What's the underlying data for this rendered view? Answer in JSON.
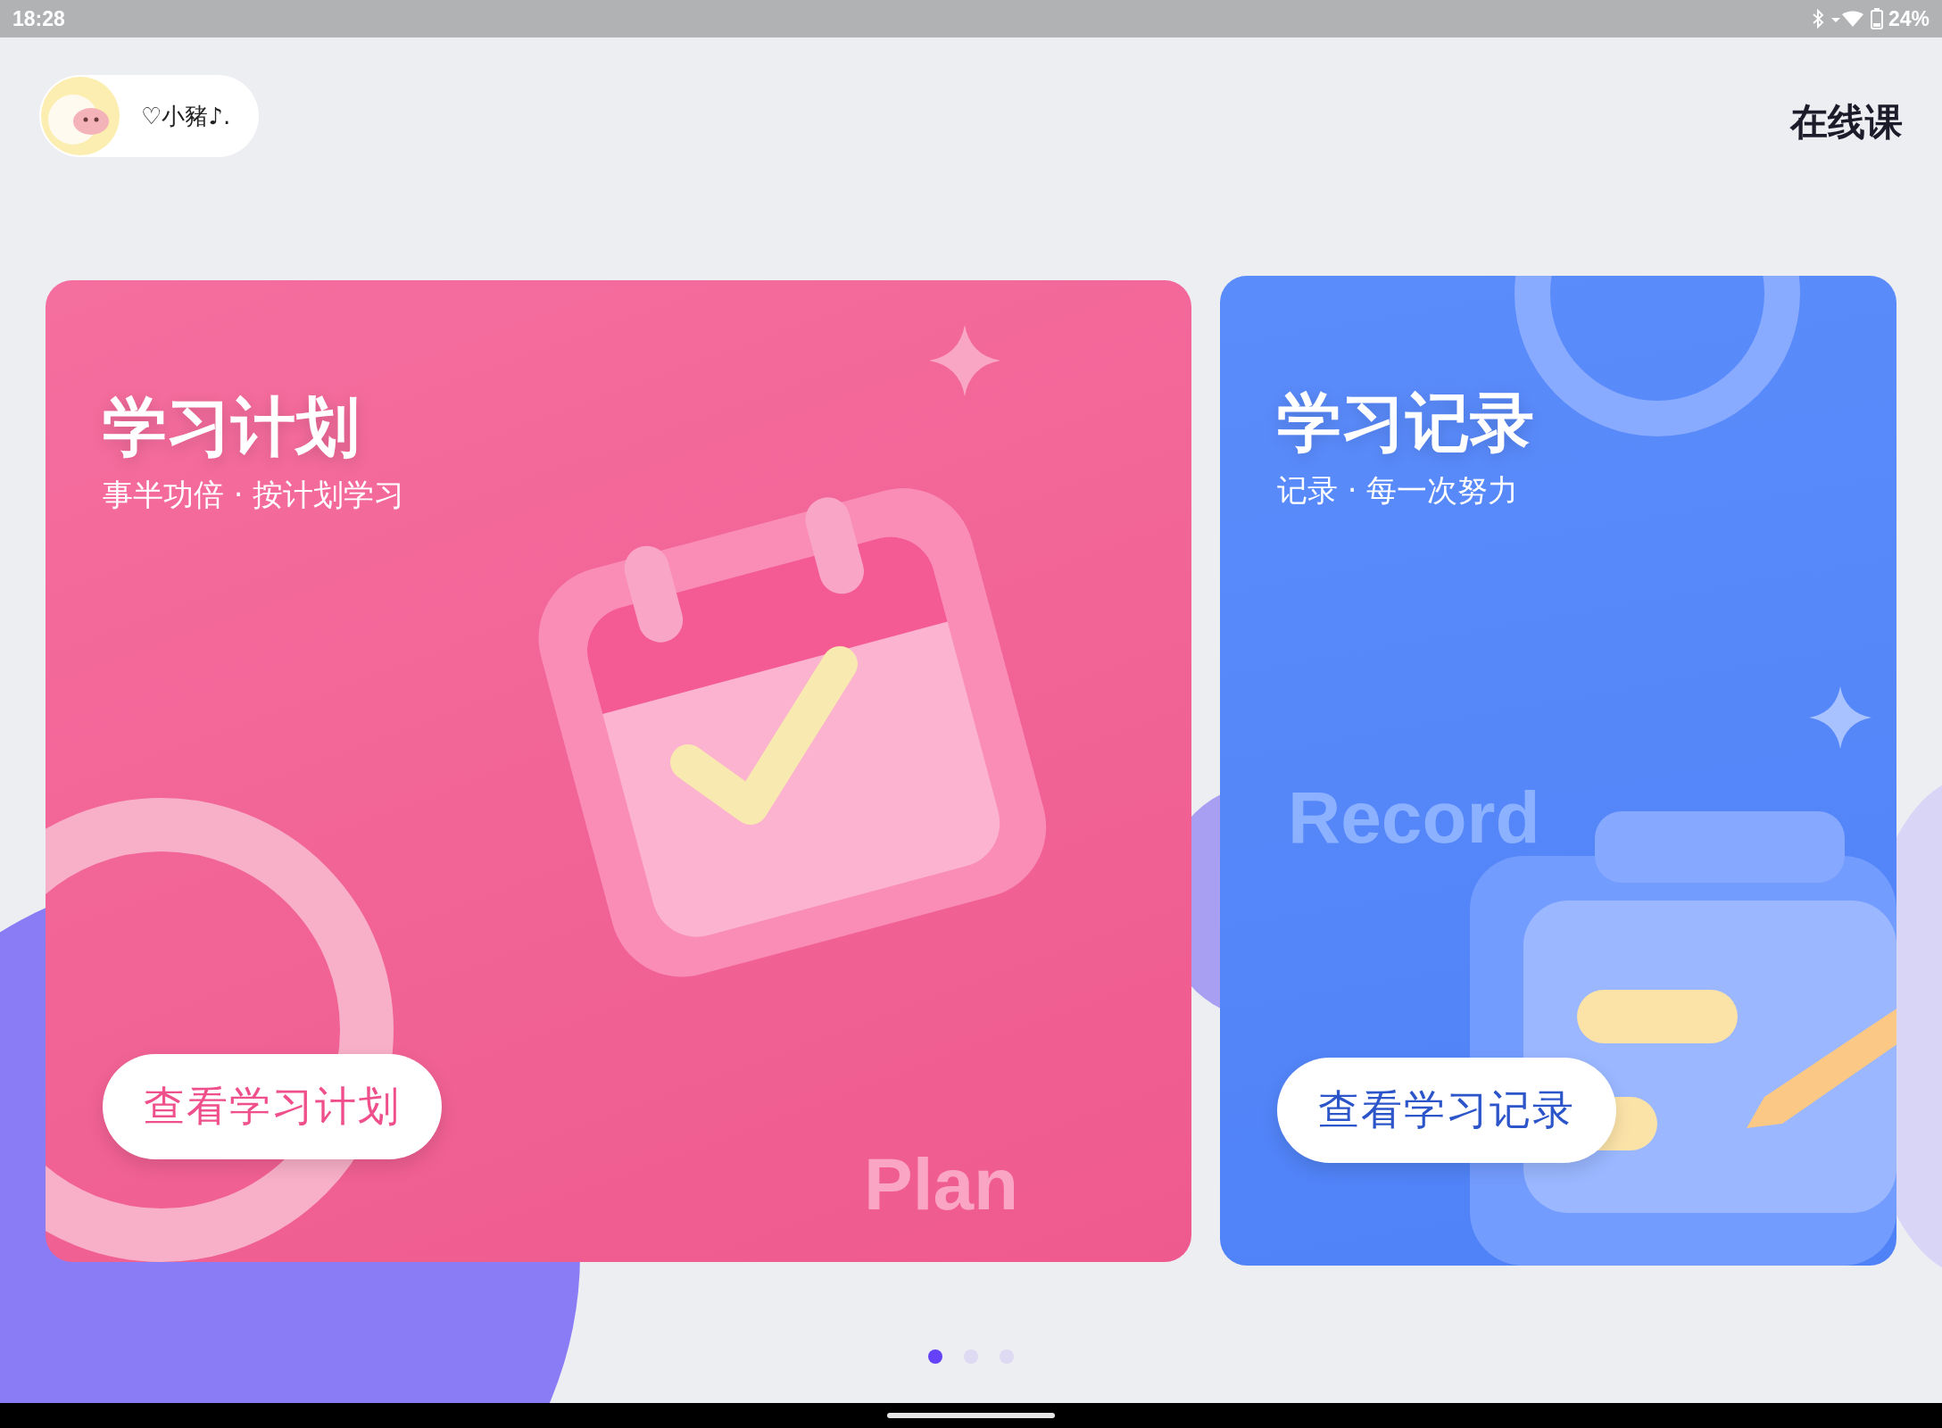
{
  "status_bar": {
    "time": "18:28",
    "battery_text": "24%"
  },
  "header": {
    "user_name": "♡小豬♪.",
    "title": "在线课"
  },
  "cards": [
    {
      "kind": "plan",
      "title": "学习计划",
      "subtitle": "事半功倍 · 按计划学习",
      "button": "查看学习计划",
      "watermark": "Plan"
    },
    {
      "kind": "record",
      "title": "学习记录",
      "subtitle": "记录 · 每一次努力",
      "button": "查看学习记录",
      "watermark": "Record"
    }
  ],
  "pager": [
    {
      "selected": true
    },
    {
      "selected": false
    },
    {
      "selected": false
    }
  ]
}
